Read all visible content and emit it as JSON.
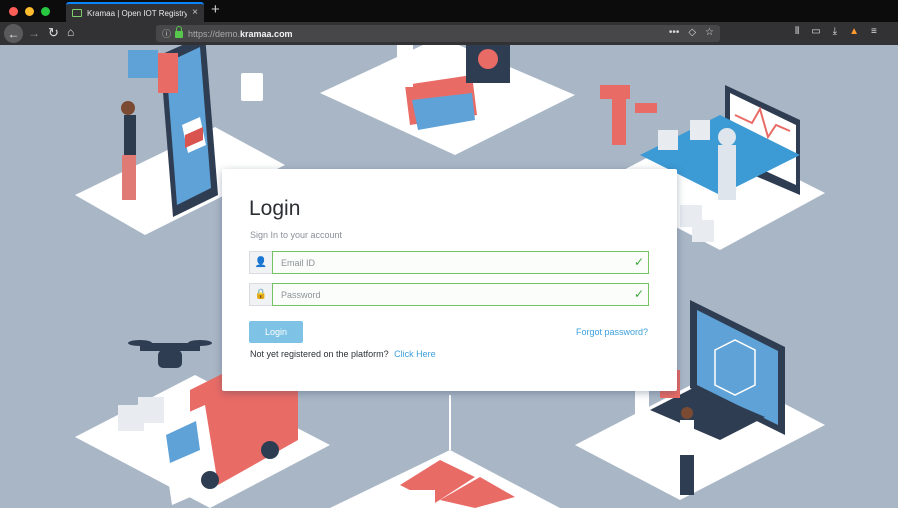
{
  "browser": {
    "tab_title": "Kramaa | Open IOT Registry on",
    "tab_close_icon": "close-icon",
    "new_tab_symbol": "+",
    "url_scheme_path": "https://demo.",
    "url_host": "kramaa.com",
    "icons": {
      "back": "←",
      "forward": "→",
      "reload": "↻",
      "home": "⌂",
      "info": "ⓘ",
      "more": "•••",
      "pocket": "◇",
      "bookmark": "☆",
      "library": "⫴",
      "sidebar": "▭",
      "download": "⤓",
      "extension": "▲",
      "menu": "≡"
    }
  },
  "login": {
    "title": "Login",
    "subtitle": "Sign In to your account",
    "email_placeholder": "Email ID",
    "password_placeholder": "Password",
    "email_icon": "👤",
    "password_icon": "🔒",
    "check_mark": "✓",
    "login_button": "Login",
    "forgot_password": "Forgot password?",
    "register_text": "Not yet registered on the platform?",
    "register_link": "Click Here"
  },
  "colors": {
    "accent": "#3d9fdc",
    "button": "#7ec3e6",
    "valid_border": "#74c365",
    "page_background": "#a8b6c6"
  }
}
